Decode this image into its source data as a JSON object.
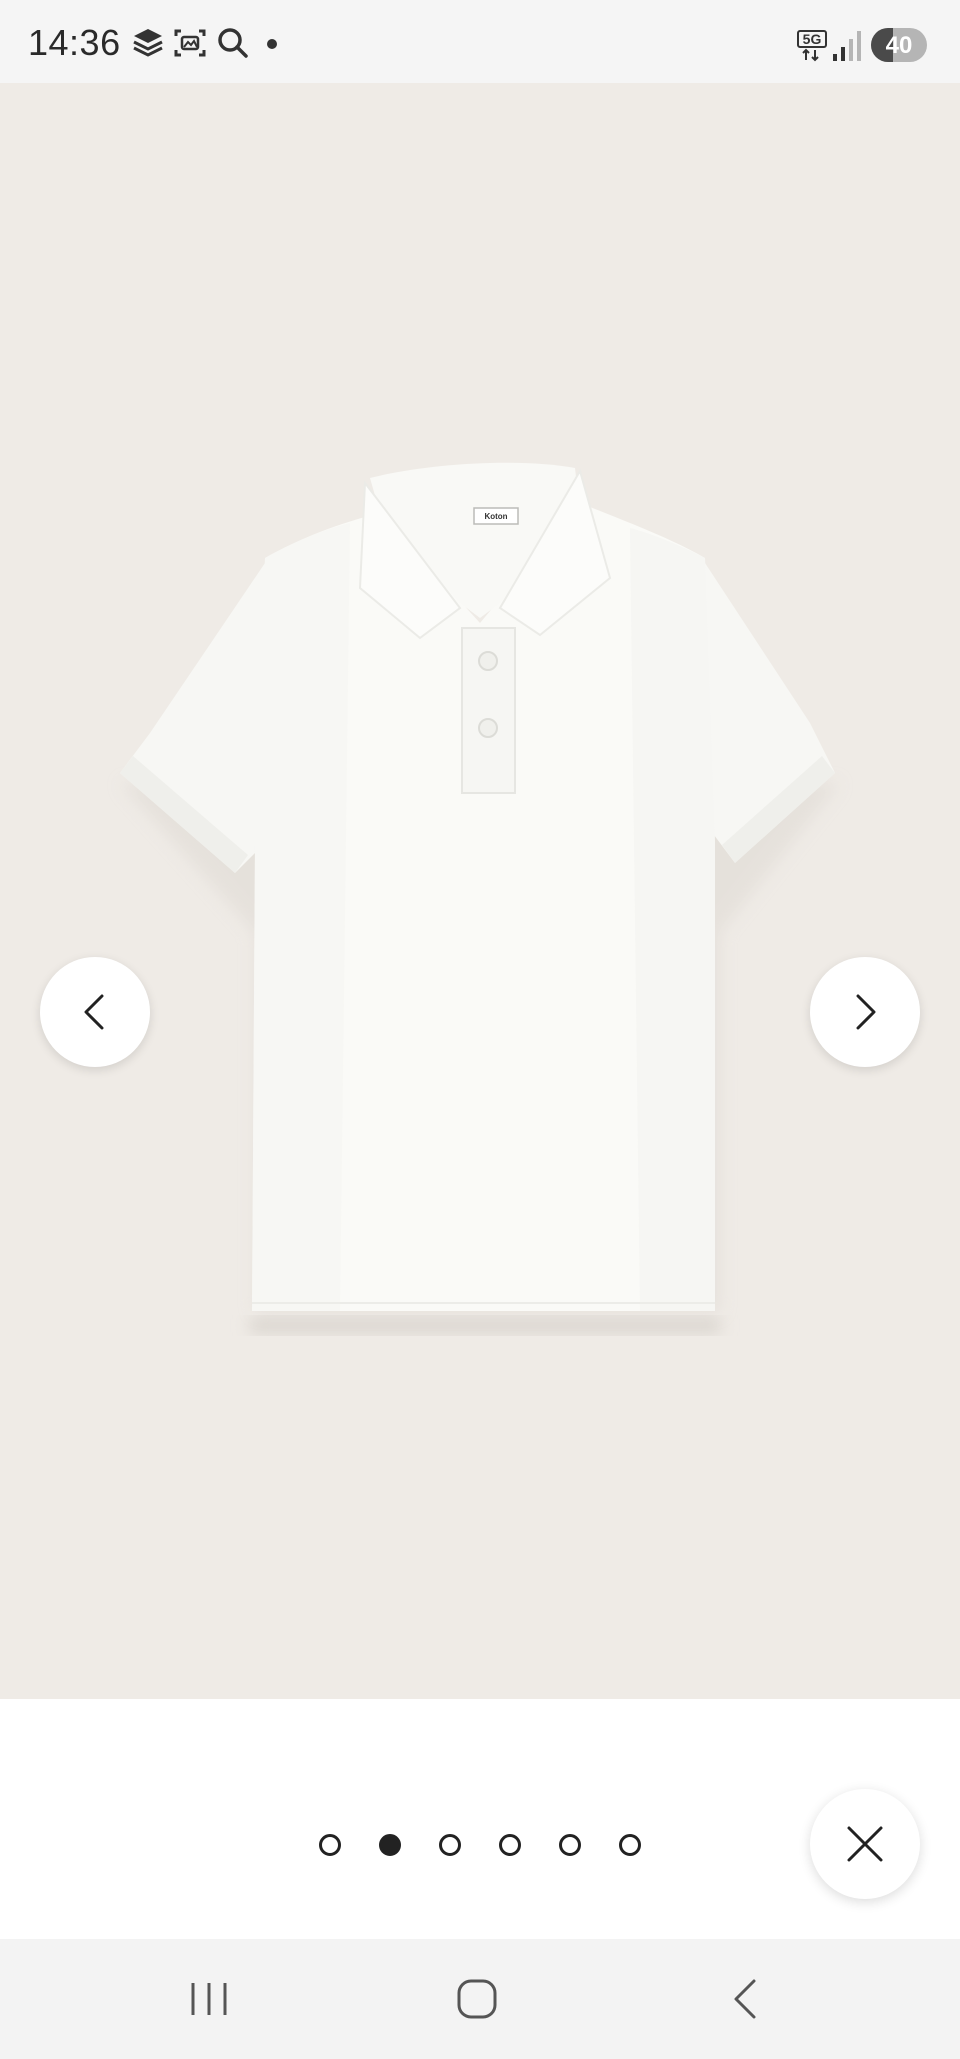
{
  "status_bar": {
    "time": "14:36",
    "network": "5G",
    "battery_level": "40",
    "battery_fraction": 0.4,
    "icons": [
      "stack-icon",
      "screenshot-icon",
      "search-icon",
      "notification-dot-icon",
      "5g-icon",
      "signal-icon",
      "battery-icon"
    ]
  },
  "gallery": {
    "image_alt": "white-polo-shirt",
    "label_text": "Koton",
    "prev_icon": "chevron-left-icon",
    "next_icon": "chevron-right-icon",
    "total_images": 6,
    "active_index": 1,
    "background_color": "#efebe6"
  },
  "close_button": {
    "icon": "close-icon"
  },
  "system_nav": {
    "recents_icon": "recents-icon",
    "home_icon": "home-icon",
    "back_icon": "back-icon"
  }
}
